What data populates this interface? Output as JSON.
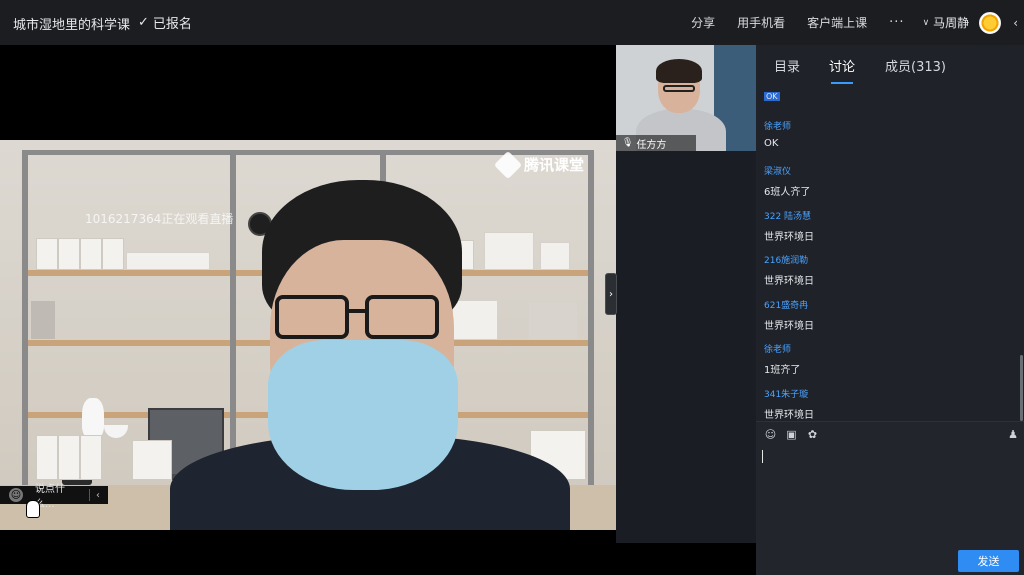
{
  "topbar": {
    "course_title": "城市湿地里的科学课",
    "enrolled_label": "已报名",
    "share": "分享",
    "watch_on_phone": "用手机看",
    "client_class": "客户端上课",
    "more": "···",
    "user_name": "马周静"
  },
  "video": {
    "viewer_overlay": "1016217364正在观看直播",
    "watermark": "腾讯课堂"
  },
  "danmu": {
    "placeholder": "说点什么..."
  },
  "side_camera": {
    "name": "任方方"
  },
  "chat": {
    "tabs": [
      {
        "label": "目录"
      },
      {
        "label": "讨论"
      },
      {
        "label": "成员(313)"
      }
    ],
    "first_badge": "OK",
    "messages": [
      {
        "sender": "徐老师",
        "text": "OK"
      },
      {
        "sender": "梁淑仪",
        "text": "6班人齐了"
      },
      {
        "sender": "322 陆汤慧",
        "text": "世界环境日"
      },
      {
        "sender": "216施润勒",
        "text": "世界环境日"
      },
      {
        "sender": "621盛奇冉",
        "text": "世界环境日"
      },
      {
        "sender": "徐老师",
        "text": "1班齐了"
      },
      {
        "sender": "341朱子璇",
        "text": "世界环境日"
      }
    ],
    "send_label": "发送"
  },
  "colors": {
    "accent": "#2f8cf3",
    "sender": "#4aa3ff",
    "panel_bg": "#1f2229",
    "topbar_bg": "#1c1d21"
  }
}
